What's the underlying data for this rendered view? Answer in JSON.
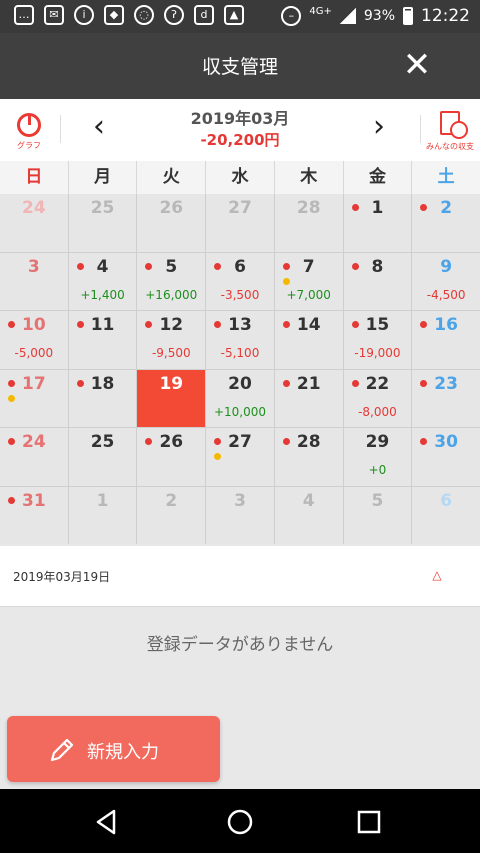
{
  "status_bar": {
    "left_icons": [
      "message-icon",
      "mail-icon",
      "info-icon",
      "lock-icon",
      "wifi-off-icon",
      "hearing-icon",
      "d-app-icon",
      "image-icon"
    ],
    "network": "4G+",
    "battery": "93%",
    "time": "12:22"
  },
  "app_bar": {
    "title": "収支管理"
  },
  "calendar_header": {
    "graph_label": "グラフ",
    "month": "2019年03月",
    "month_total": "-20,200円",
    "minna_label": "みんなの収支"
  },
  "weekdays": [
    "日",
    "月",
    "火",
    "水",
    "木",
    "金",
    "土"
  ],
  "days": [
    {
      "day": "24",
      "other": true,
      "dot": false,
      "dot2": false,
      "amount": "",
      "sign": ""
    },
    {
      "day": "25",
      "other": true,
      "dot": false,
      "dot2": false,
      "amount": "",
      "sign": ""
    },
    {
      "day": "26",
      "other": true,
      "dot": false,
      "dot2": false,
      "amount": "",
      "sign": ""
    },
    {
      "day": "27",
      "other": true,
      "dot": false,
      "dot2": false,
      "amount": "",
      "sign": ""
    },
    {
      "day": "28",
      "other": true,
      "dot": false,
      "dot2": false,
      "amount": "",
      "sign": ""
    },
    {
      "day": "1",
      "other": false,
      "dot": true,
      "dot2": false,
      "amount": "",
      "sign": ""
    },
    {
      "day": "2",
      "other": false,
      "dot": true,
      "dot2": false,
      "amount": "",
      "sign": ""
    },
    {
      "day": "3",
      "other": false,
      "dot": false,
      "dot2": false,
      "amount": "",
      "sign": ""
    },
    {
      "day": "4",
      "other": false,
      "dot": true,
      "dot2": false,
      "amount": "+1,400",
      "sign": "pos"
    },
    {
      "day": "5",
      "other": false,
      "dot": true,
      "dot2": false,
      "amount": "+16,000",
      "sign": "pos"
    },
    {
      "day": "6",
      "other": false,
      "dot": true,
      "dot2": false,
      "amount": "-3,500",
      "sign": "neg"
    },
    {
      "day": "7",
      "other": false,
      "dot": true,
      "dot2": true,
      "amount": "+7,000",
      "sign": "pos"
    },
    {
      "day": "8",
      "other": false,
      "dot": true,
      "dot2": false,
      "amount": "",
      "sign": ""
    },
    {
      "day": "9",
      "other": false,
      "dot": false,
      "dot2": false,
      "amount": "-4,500",
      "sign": "neg"
    },
    {
      "day": "10",
      "other": false,
      "dot": true,
      "dot2": false,
      "amount": "-5,000",
      "sign": "neg"
    },
    {
      "day": "11",
      "other": false,
      "dot": true,
      "dot2": false,
      "amount": "",
      "sign": ""
    },
    {
      "day": "12",
      "other": false,
      "dot": true,
      "dot2": false,
      "amount": "-9,500",
      "sign": "neg"
    },
    {
      "day": "13",
      "other": false,
      "dot": true,
      "dot2": false,
      "amount": "-5,100",
      "sign": "neg"
    },
    {
      "day": "14",
      "other": false,
      "dot": true,
      "dot2": false,
      "amount": "",
      "sign": ""
    },
    {
      "day": "15",
      "other": false,
      "dot": true,
      "dot2": false,
      "amount": "-19,000",
      "sign": "neg"
    },
    {
      "day": "16",
      "other": false,
      "dot": true,
      "dot2": false,
      "amount": "",
      "sign": ""
    },
    {
      "day": "17",
      "other": false,
      "dot": true,
      "dot2": true,
      "amount": "",
      "sign": ""
    },
    {
      "day": "18",
      "other": false,
      "dot": true,
      "dot2": false,
      "amount": "",
      "sign": ""
    },
    {
      "day": "19",
      "other": false,
      "dot": false,
      "dot2": false,
      "amount": "",
      "sign": "",
      "today": true
    },
    {
      "day": "20",
      "other": false,
      "dot": false,
      "dot2": false,
      "amount": "+10,000",
      "sign": "pos"
    },
    {
      "day": "21",
      "other": false,
      "dot": true,
      "dot2": false,
      "amount": "",
      "sign": ""
    },
    {
      "day": "22",
      "other": false,
      "dot": true,
      "dot2": false,
      "amount": "-8,000",
      "sign": "neg"
    },
    {
      "day": "23",
      "other": false,
      "dot": true,
      "dot2": false,
      "amount": "",
      "sign": ""
    },
    {
      "day": "24",
      "other": false,
      "dot": true,
      "dot2": false,
      "amount": "",
      "sign": ""
    },
    {
      "day": "25",
      "other": false,
      "dot": false,
      "dot2": false,
      "amount": "",
      "sign": ""
    },
    {
      "day": "26",
      "other": false,
      "dot": true,
      "dot2": false,
      "amount": "",
      "sign": ""
    },
    {
      "day": "27",
      "other": false,
      "dot": true,
      "dot2": true,
      "amount": "",
      "sign": ""
    },
    {
      "day": "28",
      "other": false,
      "dot": true,
      "dot2": false,
      "amount": "",
      "sign": ""
    },
    {
      "day": "29",
      "other": false,
      "dot": false,
      "dot2": false,
      "amount": "+0",
      "sign": "pos"
    },
    {
      "day": "30",
      "other": false,
      "dot": true,
      "dot2": false,
      "amount": "",
      "sign": ""
    },
    {
      "day": "31",
      "other": false,
      "dot": true,
      "dot2": false,
      "amount": "",
      "sign": ""
    },
    {
      "day": "1",
      "other": true,
      "dot": false,
      "dot2": false,
      "amount": "",
      "sign": ""
    },
    {
      "day": "2",
      "other": true,
      "dot": false,
      "dot2": false,
      "amount": "",
      "sign": ""
    },
    {
      "day": "3",
      "other": true,
      "dot": false,
      "dot2": false,
      "amount": "",
      "sign": ""
    },
    {
      "day": "4",
      "other": true,
      "dot": false,
      "dot2": false,
      "amount": "",
      "sign": ""
    },
    {
      "day": "5",
      "other": true,
      "dot": false,
      "dot2": false,
      "amount": "",
      "sign": ""
    },
    {
      "day": "6",
      "other": true,
      "dot": false,
      "dot2": false,
      "amount": "",
      "sign": ""
    }
  ],
  "selected_date": "2019年03月19日",
  "empty_message": "登録データがありません",
  "new_entry_label": "新規入力",
  "colors": {
    "accent": "#f24a35",
    "income": "#1e8f1e",
    "expense": "#e53935",
    "saturday": "#4ba3e8",
    "memo_dot": "#f5b800"
  }
}
